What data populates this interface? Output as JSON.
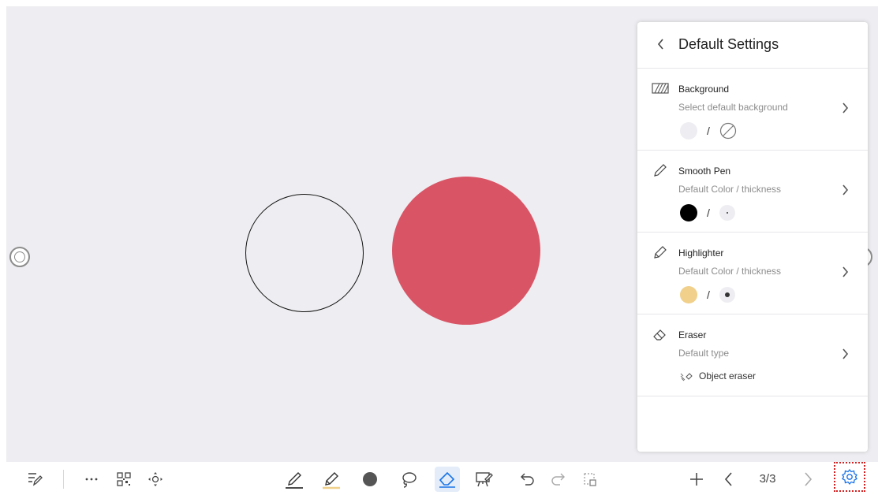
{
  "panel": {
    "title": "Default Settings",
    "sections": [
      {
        "title": "Background",
        "subtitle": "Select default background",
        "icon": "background-pattern-icon"
      },
      {
        "title": "Smooth Pen",
        "subtitle": "Default Color / thickness",
        "icon": "pen-icon",
        "color": "#000000"
      },
      {
        "title": "Highlighter",
        "subtitle": "Default Color / thickness",
        "icon": "highlighter-icon",
        "color": "#f0d08a"
      },
      {
        "title": "Eraser",
        "subtitle": "Default type",
        "icon": "eraser-icon",
        "type_label": "Object eraser"
      }
    ],
    "separator": "/"
  },
  "toolbar": {
    "page_indicator": "3/3",
    "active_tool": "eraser",
    "accent_color": "#1a73e8"
  },
  "canvas": {
    "background": "#eeeef2",
    "shape_fill_color": "#d95566"
  }
}
